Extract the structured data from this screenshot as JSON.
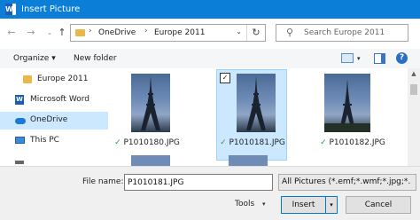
{
  "window": {
    "title": "Insert Picture",
    "app_icon_letter": "W"
  },
  "nav": {
    "back_icon": "arrow-left-icon",
    "forward_icon": "arrow-right-icon",
    "recent_icon": "chevron-down-icon",
    "up_icon": "arrow-up-icon",
    "breadcrumb": [
      "OneDrive",
      "Europe 2011"
    ],
    "separator": "›",
    "refresh_icon": "refresh-icon",
    "search_placeholder": "Search Europe 2011"
  },
  "toolbar": {
    "organize_label": "Organize",
    "new_folder_label": "New folder"
  },
  "sidebar": {
    "items": [
      {
        "label": "Europe 2011",
        "icon": "folder-icon",
        "color": "#e8b84a"
      },
      {
        "label": "Microsoft Word",
        "icon": "word-icon",
        "color": "#1b5eb8"
      },
      {
        "label": "OneDrive",
        "icon": "cloud-icon",
        "color": "#1b7ad6",
        "selected": true
      },
      {
        "label": "This PC",
        "icon": "computer-icon",
        "color": "#3a8ad6"
      }
    ]
  },
  "files": [
    {
      "name": "P1010180.JPG",
      "status": "✓",
      "selected": false
    },
    {
      "name": "P1010181.JPG",
      "status": "✓",
      "selected": true,
      "checkbox": "✓"
    },
    {
      "name": "P1010182.JPG",
      "status": "✓",
      "selected": false
    }
  ],
  "footer": {
    "file_name_label": "File name:",
    "file_name_value": "P1010181.JPG",
    "file_type_value": "All Pictures (*.emf;*.wmf;*.jpg;*.",
    "tools_label": "Tools",
    "insert_label": "Insert",
    "cancel_label": "Cancel"
  },
  "colors": {
    "accent": "#0b7fd8",
    "selection": "#cce8ff",
    "status_ok": "#2e9e3e"
  }
}
